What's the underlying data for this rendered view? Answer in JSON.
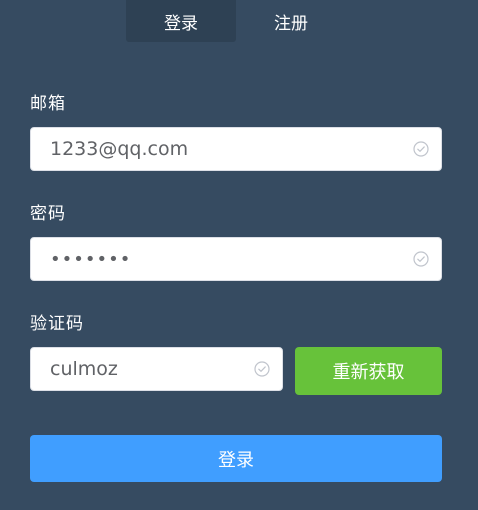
{
  "tabs": [
    {
      "label": "登录",
      "active": true
    },
    {
      "label": "注册",
      "active": false
    }
  ],
  "form": {
    "email": {
      "label": "邮箱",
      "value": "1233@qq.com",
      "icon": "check-circle-icon"
    },
    "password": {
      "label": "密码",
      "value": "1234567",
      "icon": "check-circle-icon"
    },
    "captcha": {
      "label": "验证码",
      "value": "culmoz",
      "icon": "check-circle-icon",
      "refresh_label": "重新获取"
    },
    "submit_label": "登录"
  },
  "colors": {
    "background": "#364b61",
    "active_tab": "#2e4154",
    "refresh_button": "#67c23a",
    "login_button": "#409eff",
    "valid_icon": "#c0c4cc"
  }
}
